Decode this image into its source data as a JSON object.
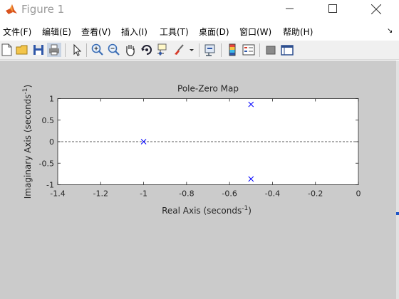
{
  "window": {
    "title": "Figure 1"
  },
  "menu": {
    "items": [
      "文件(F)",
      "编辑(E)",
      "查看(V)",
      "插入(I)",
      "工具(T)",
      "桌面(D)",
      "窗口(W)",
      "帮助(H)"
    ],
    "overflow": "↘"
  },
  "toolbar": {
    "icons": [
      "new-figure-icon",
      "open-file-icon",
      "save-icon",
      "print-icon",
      "edit-plot-arrow-icon",
      "zoom-in-icon",
      "zoom-out-icon",
      "pan-hand-icon",
      "rotate-3d-icon",
      "data-cursor-icon",
      "brush-icon",
      "brush-dropdown-icon",
      "link-plot-icon",
      "insert-colorbar-icon",
      "insert-legend-icon",
      "hide-plot-tools-icon",
      "show-plot-tools-icon"
    ]
  },
  "colors": {
    "figure_background": "#cbcbcb",
    "axes_background": "#ffffff",
    "marker": "#0000ff",
    "title_text": "#9a9a9a",
    "matlab_icon": "#d9531e"
  },
  "chart_data": {
    "type": "scatter",
    "title": "Pole-Zero Map",
    "xlabel": "Real Axis (seconds",
    "ylabel": "Imaginary Axis (seconds",
    "label_superscript": "-1",
    "label_suffix": ")",
    "xlim": [
      -1.4,
      0
    ],
    "ylim": [
      -1,
      1
    ],
    "xticks": [
      -1.4,
      -1.2,
      -1,
      -0.8,
      -0.6,
      -0.4,
      -0.2,
      0
    ],
    "xtick_labels": [
      "-1.4",
      "-1.2",
      "-1",
      "-0.8",
      "-0.6",
      "-0.4",
      "-0.2",
      "0"
    ],
    "yticks": [
      1,
      0.5,
      0,
      -0.5,
      -1
    ],
    "ytick_labels": [
      "1",
      "0.5",
      "0",
      "-0.5",
      "-1"
    ],
    "reference_line": {
      "y": 0,
      "style": "dashed"
    },
    "series": [
      {
        "marker": "x",
        "points": [
          {
            "x": -1.0,
            "y": 0.0
          },
          {
            "x": -0.5,
            "y": 0.866
          },
          {
            "x": -0.5,
            "y": -0.866
          }
        ]
      }
    ],
    "grid": false
  }
}
